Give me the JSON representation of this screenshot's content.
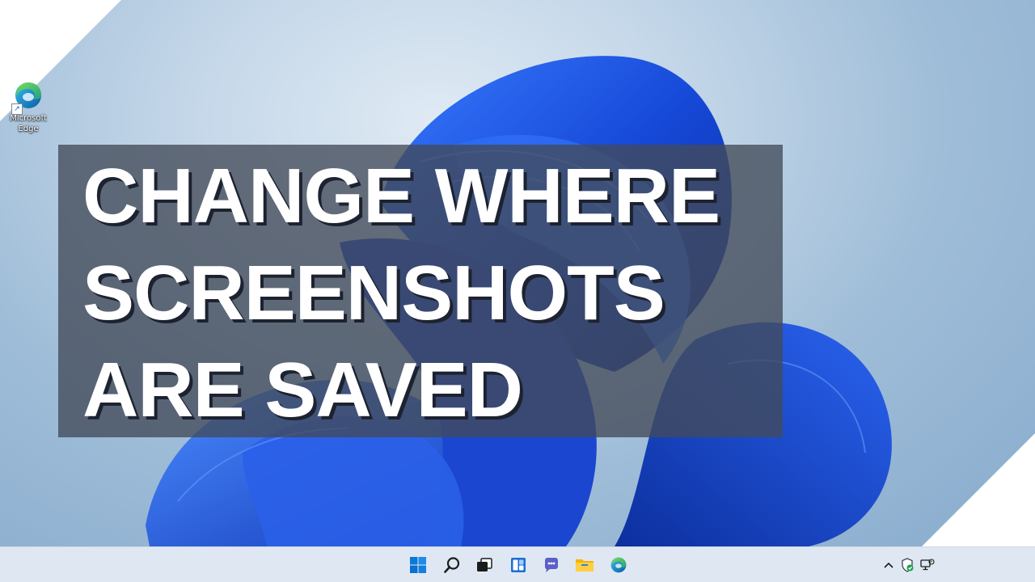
{
  "desktop": {
    "icons": [
      {
        "label": "Microsoft Edge",
        "icon": "edge-icon"
      }
    ]
  },
  "banner": {
    "lines": [
      "CHANGE WHERE",
      "SCREENSHOTS",
      "ARE SAVED"
    ],
    "text_color": "#ffffff",
    "background": "#424a58"
  },
  "taskbar": {
    "apps": [
      {
        "name": "Start",
        "icon": "windows-start-icon"
      },
      {
        "name": "Search",
        "icon": "search-icon"
      },
      {
        "name": "Task View",
        "icon": "task-view-icon"
      },
      {
        "name": "Widgets",
        "icon": "widgets-icon"
      },
      {
        "name": "Chat",
        "icon": "chat-icon"
      },
      {
        "name": "File Explorer",
        "icon": "file-explorer-icon"
      },
      {
        "name": "Microsoft Edge",
        "icon": "edge-icon"
      }
    ],
    "tray": [
      {
        "icon": "chevron-up-icon"
      },
      {
        "icon": "security-shield-icon"
      },
      {
        "icon": "network-icon"
      }
    ]
  },
  "colors": {
    "wallpaper_bloom": "#1f4fe0",
    "accent": "#0078d4"
  }
}
